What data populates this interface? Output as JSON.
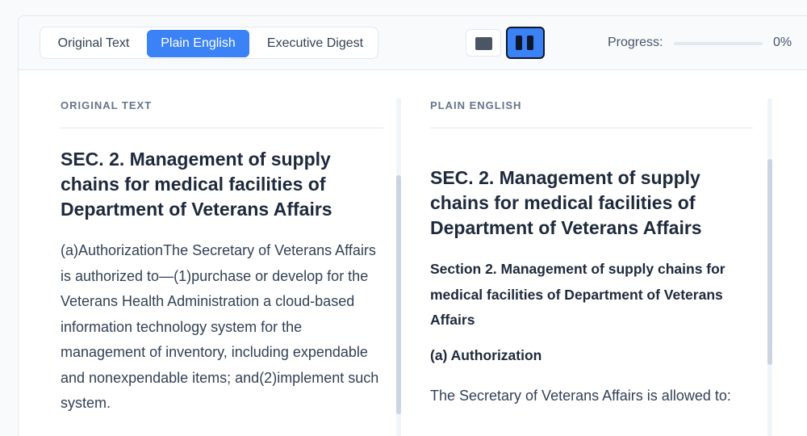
{
  "toolbar": {
    "tabs": [
      {
        "label": "Original Text",
        "active": false
      },
      {
        "label": "Plain English",
        "active": true
      },
      {
        "label": "Executive Digest",
        "active": false
      }
    ],
    "view_modes": [
      {
        "icon": "single-pane-icon",
        "active": false
      },
      {
        "icon": "split-pane-icon",
        "active": true
      }
    ],
    "progress": {
      "label": "Progress:",
      "value": "0%",
      "fraction": 0
    }
  },
  "left_pane": {
    "header": "ORIGINAL TEXT",
    "title": "SEC. 2. Management of supply chains for medical facilities of Department of Veterans Affairs",
    "body": "(a)AuthorizationThe Secretary of Veterans Affairs is authorized to—(1)purchase or develop for the Veterans Health Administration a cloud-based information technology system for the management of inventory, including expendable and nonexpendable items; and(2)implement such system."
  },
  "right_pane": {
    "header": "PLAIN ENGLISH",
    "title": "SEC. 2. Management of supply chains for medical facilities of Department of Veterans Affairs",
    "section_title": "Section 2. Management of supply chains for medical facilities of Department of Veterans Affairs",
    "subsection": "(a) Authorization",
    "text": "The Secretary of Veterans Affairs is allowed to:"
  },
  "colors": {
    "accent": "#3b82f6",
    "text": "#1e293b",
    "muted": "#64748b"
  }
}
